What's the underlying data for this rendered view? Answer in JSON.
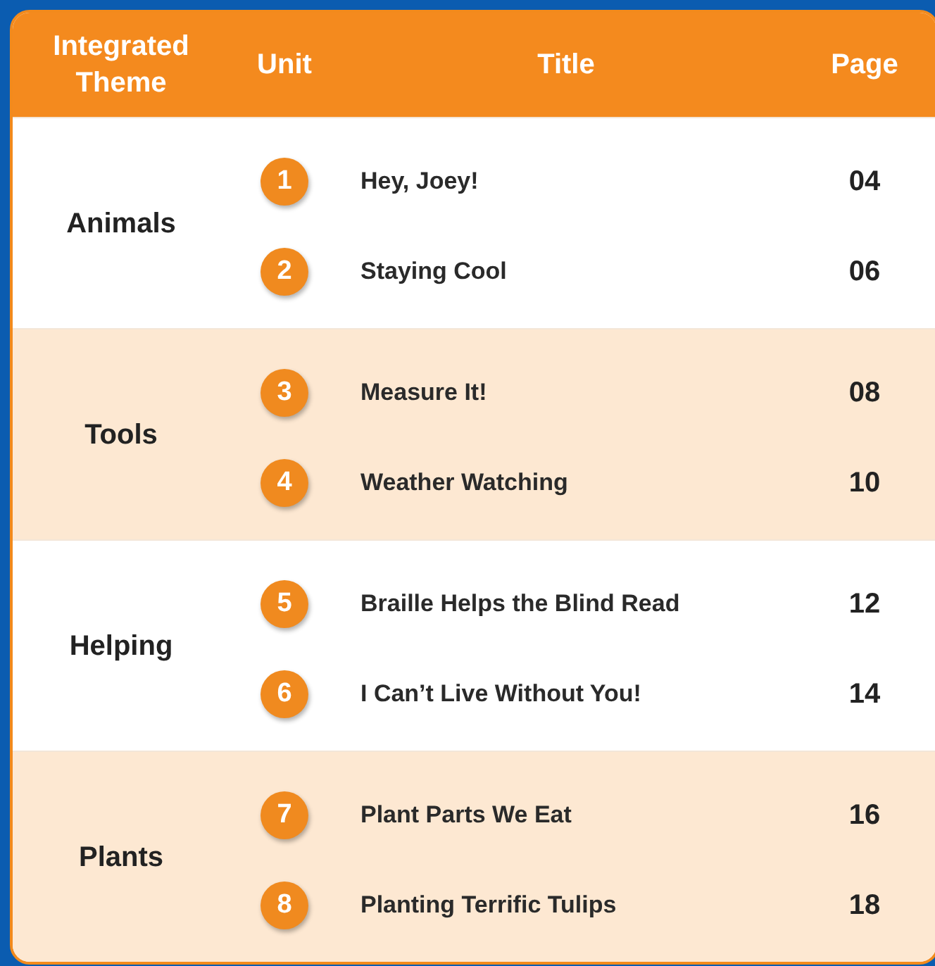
{
  "table": {
    "columns": [
      "Integrated Theme",
      "Unit",
      "Title",
      "Page"
    ],
    "groups": [
      {
        "theme": "Animals",
        "shaded": false,
        "units": [
          {
            "number": "1",
            "title": "Hey, Joey!",
            "page": "04"
          },
          {
            "number": "2",
            "title": "Staying Cool",
            "page": "06"
          }
        ]
      },
      {
        "theme": "Tools",
        "shaded": true,
        "units": [
          {
            "number": "3",
            "title": "Measure It!",
            "page": "08"
          },
          {
            "number": "4",
            "title": "Weather Watching",
            "page": "10"
          }
        ]
      },
      {
        "theme": "Helping",
        "shaded": false,
        "units": [
          {
            "number": "5",
            "title": "Braille Helps the Blind Read",
            "page": "12"
          },
          {
            "number": "6",
            "title": "I Can’t Live Without You!",
            "page": "14"
          }
        ]
      },
      {
        "theme": "Plants",
        "shaded": true,
        "units": [
          {
            "number": "7",
            "title": "Plant Parts We Eat",
            "page": "16"
          },
          {
            "number": "8",
            "title": "Planting Terrific Tulips",
            "page": "18"
          }
        ]
      }
    ]
  }
}
